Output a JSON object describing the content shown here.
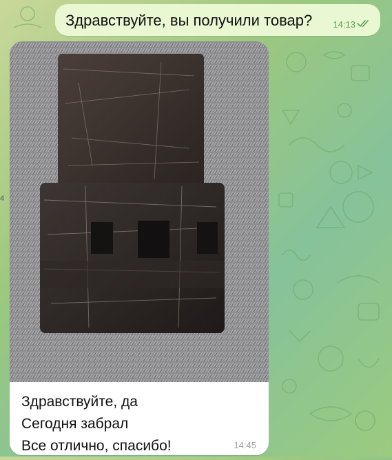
{
  "chat": {
    "outgoing": {
      "text": "Здравствуйте, вы получили товар?",
      "time": "14:13",
      "status_icon": "double-check-icon"
    },
    "incoming": {
      "image": "photo-of-wrapped-parcel",
      "caption_lines": [
        "Здравствуйте, да",
        "Сегодня забрал",
        "Все отлично, спасибо!"
      ],
      "time": "14:45"
    },
    "edge_fragment": "4"
  },
  "colors": {
    "outgoing_bubble": "#e9f7d3",
    "incoming_bubble": "#ffffff",
    "check_color": "#5aa05a",
    "wallpaper_accent": "#86c29a"
  }
}
